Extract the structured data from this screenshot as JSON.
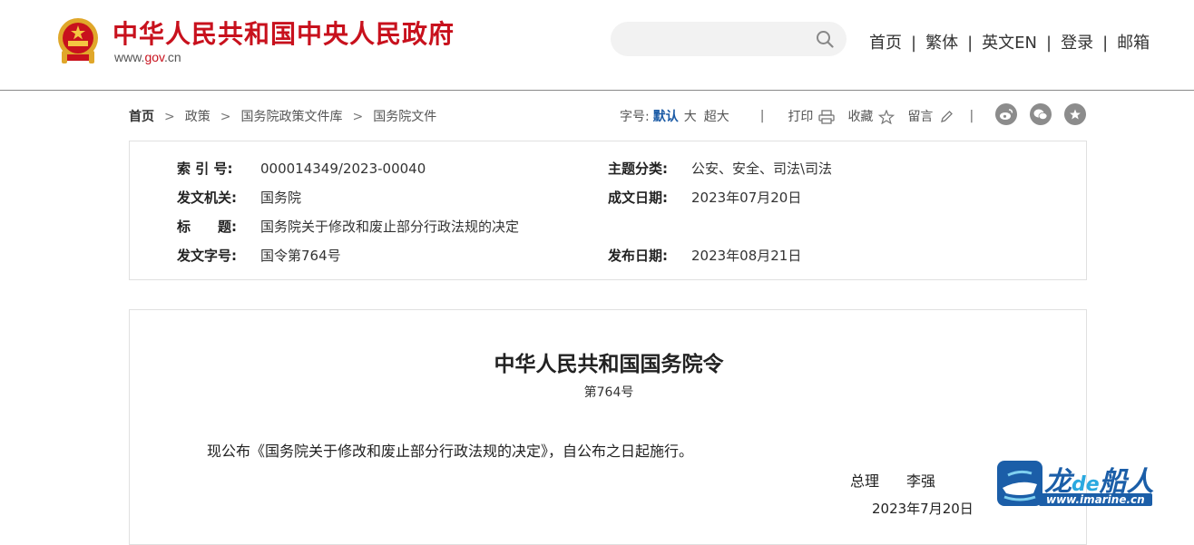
{
  "header": {
    "site_title": "中华人民共和国中央人民政府",
    "url_prefix": "www.",
    "url_gov": "gov",
    "url_suffix": ".cn",
    "search_placeholder": "",
    "nav": [
      "首页",
      "繁体",
      "英文EN",
      "登录",
      "邮箱"
    ]
  },
  "breadcrumb": {
    "items": [
      "首页",
      "政策",
      "国务院政策文件库",
      "国务院文件"
    ]
  },
  "tools": {
    "font_label": "字号:",
    "font_default": "默认",
    "font_large": "大",
    "font_xlarge": "超大",
    "print": "打印",
    "favorite": "收藏",
    "comment": "留言",
    "share_icons": [
      "weibo-icon",
      "wechat-icon",
      "star-icon"
    ]
  },
  "info": {
    "index_label": "索 引 号:",
    "index_value": "000014349/2023-00040",
    "topic_label": "主题分类:",
    "topic_value": "公安、安全、司法\\司法",
    "issuer_label": "发文机关:",
    "issuer_value": "国务院",
    "written_label": "成文日期:",
    "written_value": "2023年07月20日",
    "title_label": "标　　题:",
    "title_value": "国务院关于修改和废止部分行政法规的决定",
    "docno_label": "发文字号:",
    "docno_value": "国令第764号",
    "published_label": "发布日期:",
    "published_value": "2023年08月21日"
  },
  "document": {
    "title": "中华人民共和国国务院令",
    "number": "第764号",
    "body": "现公布《国务院关于修改和废止部分行政法规的决定》，自公布之日起施行。",
    "sign_role": "总理",
    "sign_name": "李强",
    "date": "2023年7月20日"
  },
  "watermark": {
    "brand_1": "龙",
    "brand_de": "de",
    "brand_2": "船人",
    "url": "www.imarine.cn"
  },
  "colors": {
    "brand_red": "#c8111d",
    "link_blue": "#1a5aa5",
    "icon_grey": "#8c8c8c"
  }
}
